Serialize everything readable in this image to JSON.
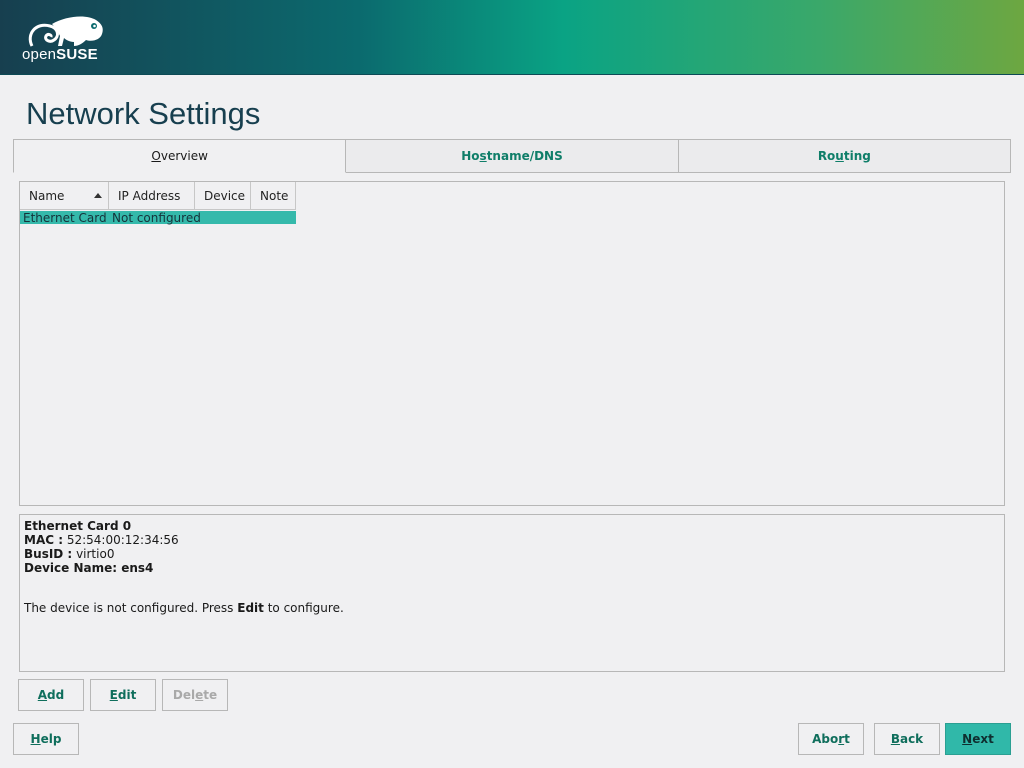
{
  "branding": {
    "logo_text_prefix": "open",
    "logo_text_brand": "SUSE",
    "logo_icon": "opensuse-chameleon-icon"
  },
  "page": {
    "title": "Network Settings"
  },
  "tabs": [
    {
      "pre": "",
      "key": "O",
      "post": "verview",
      "active": true
    },
    {
      "pre": "Ho",
      "key": "s",
      "post": "tname/DNS",
      "active": false
    },
    {
      "pre": "Ro",
      "key": "u",
      "post": "ting",
      "active": false
    }
  ],
  "table": {
    "columns": [
      "Name",
      "IP Address",
      "Device",
      "Note"
    ],
    "sort_column": "Name",
    "sort_direction": "ascending",
    "rows": [
      {
        "name": "Ethernet Card 0",
        "ip": "Not configured",
        "device": "",
        "note": "",
        "selected": true
      }
    ]
  },
  "details": {
    "title": "Ethernet Card 0",
    "mac_label": "MAC :",
    "mac_value": "52:54:00:12:34:56",
    "busid_label": "BusID :",
    "busid_value": "virtio0",
    "device_name": "Device Name: ens4",
    "message_pre": "The device is not configured. Press ",
    "message_key": "Edit",
    "message_post": " to configure."
  },
  "actions": {
    "add": {
      "key": "A",
      "rest": "dd"
    },
    "edit": {
      "key": "E",
      "rest": "dit"
    },
    "delete": {
      "pre": "Del",
      "key": "e",
      "post": "te",
      "disabled": true
    }
  },
  "footer": {
    "help": {
      "key": "H",
      "rest": "elp"
    },
    "abort": {
      "pre": "Abo",
      "key": "r",
      "post": "t"
    },
    "back": {
      "key": "B",
      "rest": "ack"
    },
    "next": {
      "key": "N",
      "rest": "ext"
    }
  },
  "colors": {
    "selection": "#35b9ab",
    "accent_text": "#0f7e69",
    "title": "#173f4f"
  }
}
